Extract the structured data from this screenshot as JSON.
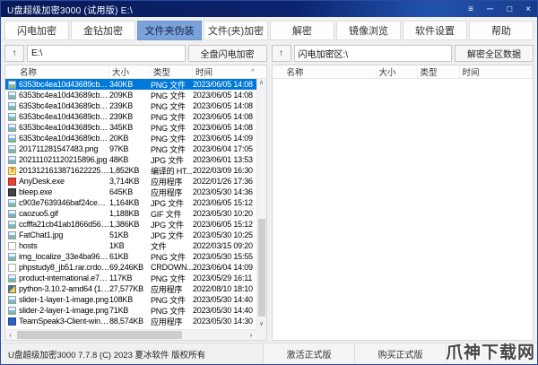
{
  "window": {
    "title": "U盘超级加密3000 (试用版)  E:\\",
    "controls": {
      "menu": "≡",
      "minimize": "─",
      "maximize": "□",
      "close": "×"
    }
  },
  "toolbar": {
    "tabs": [
      {
        "id": "flash-encrypt",
        "label": "闪电加密",
        "active": false
      },
      {
        "id": "gold-encrypt",
        "label": "金钻加密",
        "active": false
      },
      {
        "id": "folder-disguise",
        "label": "文件夹伪装",
        "active": true
      },
      {
        "id": "file-encrypt",
        "label": "文件(夹)加密",
        "active": false
      },
      {
        "id": "decrypt",
        "label": "解密",
        "active": false
      },
      {
        "id": "image-browse",
        "label": "镜像浏览",
        "active": false
      },
      {
        "id": "settings",
        "label": "软件设置",
        "active": false
      },
      {
        "id": "help",
        "label": "帮助",
        "active": false
      }
    ]
  },
  "left_panel": {
    "up_label": "↑",
    "path": "E:\\",
    "action": "全盘闪电加密",
    "columns": [
      "名称",
      "大小",
      "类型",
      "时间"
    ],
    "sort_indicator": "^",
    "rows": [
      {
        "name": "6353bc4ea10d43689cb983a...",
        "size": "340KB",
        "type": "PNG 文件",
        "date": "2023/06/05 14:08",
        "icon": "image-file",
        "selected": true
      },
      {
        "name": "6353bc4ea10d43689cb983a...",
        "size": "209KB",
        "type": "PNG 文件",
        "date": "2023/06/05 14:08",
        "icon": "image-file"
      },
      {
        "name": "6353bc4ea10d43689cb983a...",
        "size": "239KB",
        "type": "PNG 文件",
        "date": "2023/06/05 14:08",
        "icon": "image-file"
      },
      {
        "name": "6353bc4ea10d43689cb983a...",
        "size": "239KB",
        "type": "PNG 文件",
        "date": "2023/06/05 14:08",
        "icon": "image-file"
      },
      {
        "name": "6353bc4ea10d43689cb983a...",
        "size": "345KB",
        "type": "PNG 文件",
        "date": "2023/06/05 14:08",
        "icon": "image-file"
      },
      {
        "name": "6353bc4ea10d43689cb983a...",
        "size": "20KB",
        "type": "PNG 文件",
        "date": "2023/06/05 14:09",
        "icon": "image-file"
      },
      {
        "name": "201711281547483.png",
        "size": "97KB",
        "type": "PNG 文件",
        "date": "2023/06/04 17:05",
        "icon": "image-file"
      },
      {
        "name": "202111021120215896.jpg",
        "size": "48KB",
        "type": "JPG 文件",
        "date": "2023/06/01 13:53",
        "icon": "image-file"
      },
      {
        "name": "201312161387162222510.chm",
        "size": "1,852KB",
        "type": "编译的 HT...",
        "date": "2022/03/09 16:30",
        "icon": "help-file"
      },
      {
        "name": "AnyDesk.exe",
        "size": "3,714KB",
        "type": "应用程序",
        "date": "2022/01/26 17:36",
        "icon": "application-red"
      },
      {
        "name": "bleep.exe",
        "size": "645KB",
        "type": "应用程序",
        "date": "2023/05/30 14:36",
        "icon": "application-dark"
      },
      {
        "name": "c903e7639346baf24ce9d375...",
        "size": "1,164KB",
        "type": "JPG 文件",
        "date": "2023/06/05 15:12",
        "icon": "image-file"
      },
      {
        "name": "caozuo5.gif",
        "size": "1,188KB",
        "type": "GIF 文件",
        "date": "2023/05/30 10:20",
        "icon": "image-file"
      },
      {
        "name": "ccfffa21cb41ab1866d5673e4...",
        "size": "1,386KB",
        "type": "JPG 文件",
        "date": "2023/06/05 15:12",
        "icon": "image-file"
      },
      {
        "name": "FatChat1.jpg",
        "size": "51KB",
        "type": "JPG 文件",
        "date": "2023/05/30 10:25",
        "icon": "image-file"
      },
      {
        "name": "hosts",
        "size": "1KB",
        "type": "文件",
        "date": "2022/03/15 09:20",
        "icon": "plain-file"
      },
      {
        "name": "img_localize_33e4ba965dab...",
        "size": "61KB",
        "type": "PNG 文件",
        "date": "2023/05/30 15:55",
        "icon": "image-file"
      },
      {
        "name": "phpstudy8_jb51.rar.crdownl...",
        "size": "69,246KB",
        "type": "CRDOWN...",
        "date": "2023/06/04 14:09",
        "icon": "plain-file"
      },
      {
        "name": "product-international.e74b5...",
        "size": "117KB",
        "type": "PNG 文件",
        "date": "2023/05/29 16:11",
        "icon": "image-file"
      },
      {
        "name": "python-3.10.2-amd64 (1).exe",
        "size": "27,577KB",
        "type": "应用程序",
        "date": "2022/08/10 18:10",
        "icon": "application-python"
      },
      {
        "name": "slider-1-layer-1-image.png",
        "size": "108KB",
        "type": "PNG 文件",
        "date": "2023/05/30 14:40",
        "icon": "image-file"
      },
      {
        "name": "slider-2-layer-1-image.png",
        "size": "71KB",
        "type": "PNG 文件",
        "date": "2023/05/30 14:40",
        "icon": "image-file"
      },
      {
        "name": "TeamSpeak3-Client-win64-3...",
        "size": "88,574KB",
        "type": "应用程序",
        "date": "2023/05/30 14:30",
        "icon": "application-blue"
      }
    ]
  },
  "right_panel": {
    "up_label": "↑",
    "path": "闪电加密区:\\",
    "action": "解密全区数据",
    "columns": [
      "名称",
      "大小",
      "类型",
      "时间"
    ],
    "rows": []
  },
  "scrollbars": {
    "up": "∧",
    "down": "∨",
    "left": "‹",
    "right": "›"
  },
  "statusbar": {
    "copyright": "U盘超级加密3000 7.7.8 (C) 2023 夏冰软件 版权所有",
    "buttons": [
      "激活正式版",
      "购买正式版",
      ""
    ]
  },
  "watermark": "爪神下载网",
  "colors": {
    "titlebar": "#0B2168",
    "active_tab": "#7BA3D9",
    "selection": "#0078D7",
    "window_border": "#2B4B9E"
  }
}
